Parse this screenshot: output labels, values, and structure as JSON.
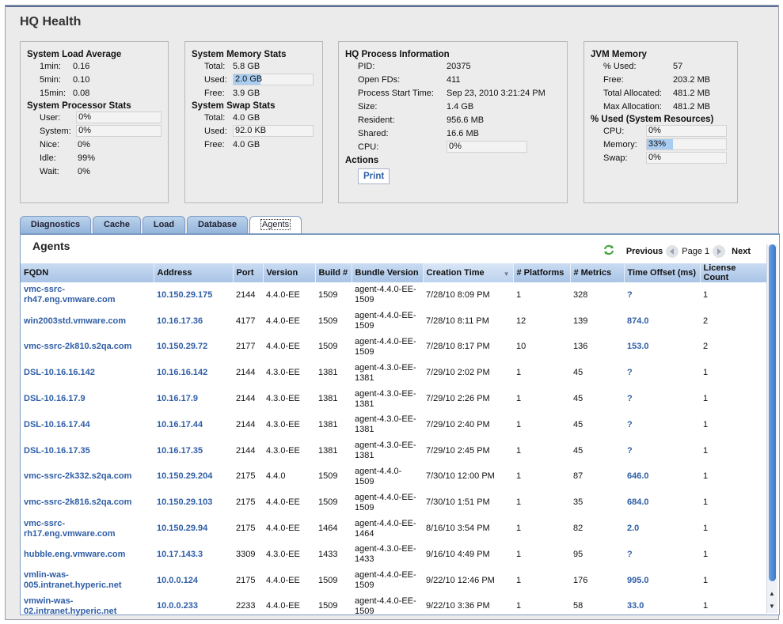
{
  "page_title": "HQ Health",
  "load": {
    "title": "System Load Average",
    "rows": [
      {
        "k": "1min:",
        "v": "0.16"
      },
      {
        "k": "5min:",
        "v": "0.10"
      },
      {
        "k": "15min:",
        "v": "0.08"
      }
    ]
  },
  "proc": {
    "title": "System Processor Stats",
    "rows": [
      {
        "k": "User:",
        "v": "0%"
      },
      {
        "k": "System:",
        "v": "0%"
      },
      {
        "k": "Nice:",
        "v": "0%"
      },
      {
        "k": "Idle:",
        "v": "99%"
      },
      {
        "k": "Wait:",
        "v": "0%"
      }
    ]
  },
  "mem": {
    "title": "System Memory Stats",
    "total": {
      "k": "Total:",
      "v": "5.8 GB"
    },
    "used": {
      "k": "Used:",
      "v": "2.0 GB",
      "fraction": 0.34
    },
    "free": {
      "k": "Free:",
      "v": "3.9 GB"
    }
  },
  "swap": {
    "title": "System Swap Stats",
    "total": {
      "k": "Total:",
      "v": "4.0 GB"
    },
    "used": {
      "k": "Used:",
      "v": "92.0 KB"
    },
    "free": {
      "k": "Free:",
      "v": "4.0 GB"
    }
  },
  "hqproc": {
    "title": "HQ Process Information",
    "rows": [
      {
        "k": "PID:",
        "v": "20375"
      },
      {
        "k": "Open FDs:",
        "v": "411"
      },
      {
        "k": "Process Start Time:",
        "v": "Sep 23, 2010 3:21:24 PM"
      },
      {
        "k": "Size:",
        "v": "1.4 GB"
      },
      {
        "k": "Resident:",
        "v": "956.6 MB"
      },
      {
        "k": "Shared:",
        "v": "16.6 MB"
      }
    ],
    "cpu": {
      "k": "CPU:",
      "v": "0%"
    },
    "actions_title": "Actions",
    "print_label": "Print"
  },
  "jvm": {
    "title": "JVM Memory",
    "rows": [
      {
        "k": "% Used:",
        "v": "57"
      },
      {
        "k": "Free:",
        "v": "203.2 MB"
      },
      {
        "k": "Total Allocated:",
        "v": "481.2 MB"
      },
      {
        "k": "Max Allocation:",
        "v": "481.2 MB"
      }
    ],
    "res_title": "% Used (System Resources)",
    "cpu": {
      "k": "CPU:",
      "v": "0%"
    },
    "memory": {
      "k": "Memory:",
      "v": "33%",
      "fraction": 0.33
    },
    "swap": {
      "k": "Swap:",
      "v": "0%"
    }
  },
  "tabs": [
    "Diagnostics",
    "Cache",
    "Load",
    "Database",
    "Agents"
  ],
  "active_tab": "Agents",
  "agents": {
    "title": "Agents",
    "previous": "Previous",
    "page": "Page 1",
    "next": "Next",
    "columns": [
      "FQDN",
      "Address",
      "Port",
      "Version",
      "Build #",
      "Bundle Version",
      "Creation Time",
      "# Platforms",
      "# Metrics",
      "Time Offset (ms)",
      "License Count"
    ],
    "rows": [
      [
        "vmc-ssrc-rh47.eng.vmware.com",
        "10.150.29.175",
        "2144",
        "4.4.0-EE",
        "1509",
        "agent-4.4.0-EE-1509",
        "7/28/10 8:09 PM",
        "1",
        "328",
        "?",
        "1"
      ],
      [
        "win2003std.vmware.com",
        "10.16.17.36",
        "4177",
        "4.4.0-EE",
        "1509",
        "agent-4.4.0-EE-1509",
        "7/28/10 8:11 PM",
        "12",
        "139",
        "874.0",
        "2"
      ],
      [
        "vmc-ssrc-2k810.s2qa.com",
        "10.150.29.72",
        "2177",
        "4.4.0-EE",
        "1509",
        "agent-4.4.0-EE-1509",
        "7/28/10 8:17 PM",
        "10",
        "136",
        "153.0",
        "2"
      ],
      [
        "DSL-10.16.16.142",
        "10.16.16.142",
        "2144",
        "4.3.0-EE",
        "1381",
        "agent-4.3.0-EE-1381",
        "7/29/10 2:02 PM",
        "1",
        "45",
        "?",
        "1"
      ],
      [
        "DSL-10.16.17.9",
        "10.16.17.9",
        "2144",
        "4.3.0-EE",
        "1381",
        "agent-4.3.0-EE-1381",
        "7/29/10 2:26 PM",
        "1",
        "45",
        "?",
        "1"
      ],
      [
        "DSL-10.16.17.44",
        "10.16.17.44",
        "2144",
        "4.3.0-EE",
        "1381",
        "agent-4.3.0-EE-1381",
        "7/29/10 2:40 PM",
        "1",
        "45",
        "?",
        "1"
      ],
      [
        "DSL-10.16.17.35",
        "10.16.17.35",
        "2144",
        "4.3.0-EE",
        "1381",
        "agent-4.3.0-EE-1381",
        "7/29/10 2:45 PM",
        "1",
        "45",
        "?",
        "1"
      ],
      [
        "vmc-ssrc-2k332.s2qa.com",
        "10.150.29.204",
        "2175",
        "4.4.0",
        "1509",
        "agent-4.4.0-1509",
        "7/30/10 12:00 PM",
        "1",
        "87",
        "646.0",
        "1"
      ],
      [
        "vmc-ssrc-2k816.s2qa.com",
        "10.150.29.103",
        "2175",
        "4.4.0-EE",
        "1509",
        "agent-4.4.0-EE-1509",
        "7/30/10 1:51 PM",
        "1",
        "35",
        "684.0",
        "1"
      ],
      [
        "vmc-ssrc-rh17.eng.vmware.com",
        "10.150.29.94",
        "2175",
        "4.4.0-EE",
        "1464",
        "agent-4.4.0-EE-1464",
        "8/16/10 3:54 PM",
        "1",
        "82",
        "2.0",
        "1"
      ],
      [
        "hubble.eng.vmware.com",
        "10.17.143.3",
        "3309",
        "4.3.0-EE",
        "1433",
        "agent-4.3.0-EE-1433",
        "9/16/10 4:49 PM",
        "1",
        "95",
        "?",
        "1"
      ],
      [
        "vmlin-was-005.intranet.hyperic.net",
        "10.0.0.124",
        "2175",
        "4.4.0-EE",
        "1509",
        "agent-4.4.0-EE-1509",
        "9/22/10 12:46 PM",
        "1",
        "176",
        "995.0",
        "1"
      ],
      [
        "vmwin-was-02.intranet.hyperic.net",
        "10.0.0.233",
        "2233",
        "4.4.0-EE",
        "1509",
        "agent-4.4.0-EE-1509",
        "9/22/10 3:36 PM",
        "1",
        "58",
        "33.0",
        "1"
      ]
    ]
  }
}
